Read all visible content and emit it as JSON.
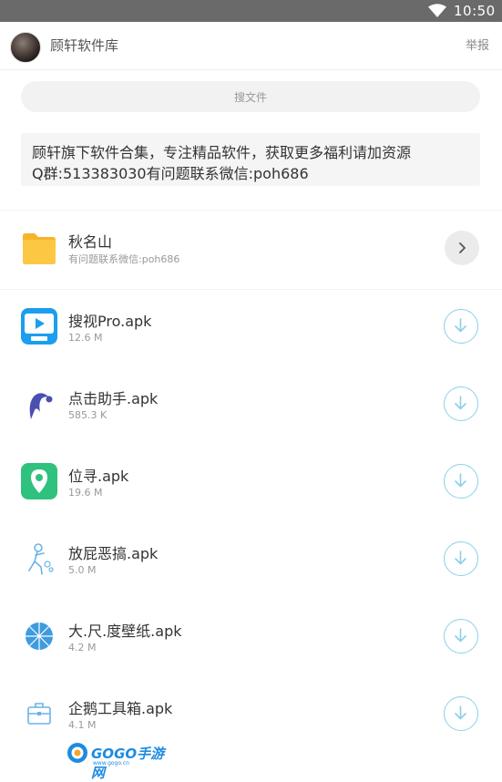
{
  "status_bar": {
    "time": "10:50"
  },
  "header": {
    "title": "顾轩软件库",
    "report_label": "举报"
  },
  "search": {
    "label": "搜文件"
  },
  "notice": {
    "line1": "顾轩旗下软件合集，专注精品软件，获取更多福利请加资源",
    "line2": "Q群:513383030有问题联系微信:poh686"
  },
  "folder": {
    "name": "秋名山",
    "subtitle": "有问题联系微信:poh686"
  },
  "files": [
    {
      "name": "搜视Pro.apk",
      "size": "12.6 M",
      "icon": "souship-app-icon"
    },
    {
      "name": "点击助手.apk",
      "size": "585.3 K",
      "icon": "click-helper-app-icon"
    },
    {
      "name": "位寻.apk",
      "size": "19.6 M",
      "icon": "location-app-icon"
    },
    {
      "name": "放屁恶搞.apk",
      "size": "5.0 M",
      "icon": "prank-app-icon"
    },
    {
      "name": "大.尺.度壁纸.apk",
      "size": "4.2 M",
      "icon": "wallpaper-app-icon"
    },
    {
      "name": "企鹅工具箱.apk",
      "size": "4.1 M",
      "icon": "toolbox-app-icon"
    }
  ],
  "watermark": {
    "text": "GOGO手游网",
    "url": "www.gogo.cn"
  },
  "colors": {
    "accent": "#8ad0e8",
    "status_bar": "#6a6a6a",
    "folder": "#fbc33b"
  }
}
